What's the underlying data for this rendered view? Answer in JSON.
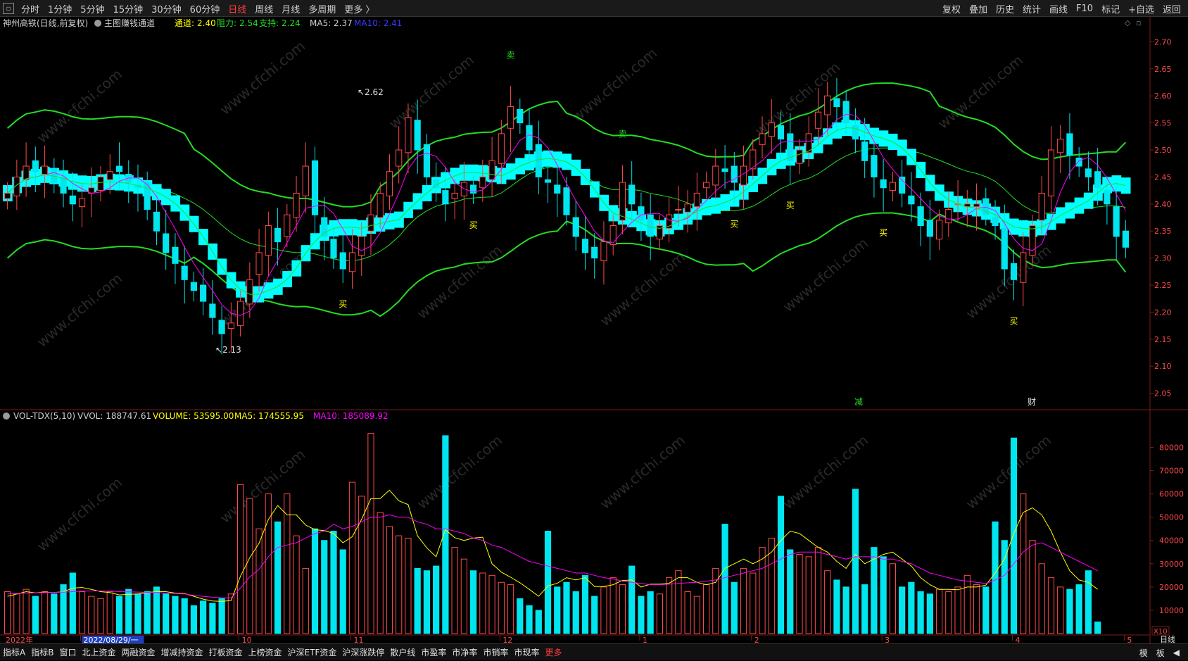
{
  "topbar": {
    "periods": [
      "分时",
      "1分钟",
      "5分钟",
      "15分钟",
      "30分钟",
      "60分钟",
      "日线",
      "周线",
      "月线",
      "多周期",
      "更多 〉"
    ],
    "active_period": "日线",
    "tools": [
      "复权",
      "叠加",
      "历史",
      "统计",
      "画线",
      "F10",
      "标记",
      "+自选",
      "返回"
    ]
  },
  "price_header": {
    "stock": "神州高铁(日线,前复权)",
    "indicator": "主图赚钱通道",
    "channel_label": "通道:",
    "channel_value": "2.40",
    "resist_label": "阻力:",
    "resist_value": "2.54",
    "support_label": "支持:",
    "support_value": "2.24",
    "ma5": "MA5: 2.37",
    "ma10": "MA10: 2.41"
  },
  "volume_header": {
    "name": "VOL-TDX(5,10)",
    "vvol": "VVOL: 188747.61",
    "volume": "VOLUME: 53595.00",
    "ma5": "MA5: 174555.95",
    "ma10": "MA10: 185089.92"
  },
  "annotations": {
    "high_label": "2.62",
    "low_label": "2.13",
    "buy": "买",
    "sell": "卖",
    "event_reduce": "减",
    "event_fin": "财",
    "unit_badge": "X10",
    "period_badge": "日线"
  },
  "axes": {
    "price_ticks": [
      "2.70",
      "2.65",
      "2.60",
      "2.55",
      "2.50",
      "2.45",
      "2.40",
      "2.35",
      "2.30",
      "2.25",
      "2.20",
      "2.15",
      "2.10",
      "2.05"
    ],
    "volume_ticks": [
      "80000",
      "70000",
      "60000",
      "50000",
      "40000",
      "30000",
      "20000",
      "10000"
    ],
    "time_labels": [
      "2022年",
      "2022/08/29/一",
      "10",
      "11",
      "12",
      "1",
      "2",
      "3",
      "4",
      "5"
    ]
  },
  "bottom_tabs": [
    "指标A",
    "指标B",
    "窗口",
    "北上资金",
    "两融资金",
    "增减持资金",
    "打板资金",
    "上榜资金",
    "沪深ETF资金",
    "沪深涨跌停",
    "散户线",
    "市盈率",
    "市净率",
    "市销率",
    "市现率",
    "更多"
  ],
  "bottom_right": [
    "模",
    "板",
    "◀"
  ],
  "watermark": "www.cfchi.com",
  "colors": {
    "up": "#ff4a4a",
    "down": "#00e5ee",
    "ma5": "#ffff00",
    "ma10": "#ff00ff",
    "band": "#22dd22",
    "channel": "#00ffff",
    "buy_text": "#ffff00",
    "sell_text": "#22dd22"
  },
  "chart_data": {
    "type": "candlestick",
    "title": "神州高铁(日线,前复权)",
    "ylim_price": [
      2.03,
      2.72
    ],
    "ylim_volume": [
      0,
      88000
    ],
    "price_extremes": {
      "high": 2.62,
      "low": 2.13
    },
    "closes": [
      2.42,
      2.45,
      2.47,
      2.46,
      2.47,
      2.44,
      2.42,
      2.4,
      2.41,
      2.43,
      2.45,
      2.46,
      2.46,
      2.44,
      2.43,
      2.39,
      2.35,
      2.31,
      2.29,
      2.26,
      2.24,
      2.22,
      2.19,
      2.16,
      2.18,
      2.22,
      2.26,
      2.31,
      2.36,
      2.33,
      2.38,
      2.42,
      2.47,
      2.38,
      2.34,
      2.3,
      2.28,
      2.31,
      2.34,
      2.38,
      2.42,
      2.46,
      2.5,
      2.56,
      2.5,
      2.45,
      2.43,
      2.4,
      2.42,
      2.44,
      2.42,
      2.45,
      2.48,
      2.53,
      2.58,
      2.55,
      2.5,
      2.45,
      2.44,
      2.42,
      2.38,
      2.34,
      2.31,
      2.3,
      2.33,
      2.36,
      2.44,
      2.4,
      2.37,
      2.34,
      2.36,
      2.38,
      2.39,
      2.4,
      2.42,
      2.44,
      2.47,
      2.46,
      2.44,
      2.47,
      2.5,
      2.53,
      2.55,
      2.52,
      2.48,
      2.5,
      2.53,
      2.57,
      2.6,
      2.58,
      2.55,
      2.52,
      2.48,
      2.45,
      2.43,
      2.44,
      2.42,
      2.4,
      2.36,
      2.34,
      2.37,
      2.39,
      2.4,
      2.4,
      2.4,
      2.38,
      2.36,
      2.28,
      2.26,
      2.31,
      2.36,
      2.42,
      2.5,
      2.52,
      2.49,
      2.47,
      2.45,
      2.43,
      2.4,
      2.34,
      2.32
    ],
    "volumes": [
      18000,
      17000,
      19000,
      16000,
      18000,
      17000,
      21000,
      26000,
      18000,
      16000,
      15000,
      18000,
      16000,
      19000,
      17000,
      18000,
      20000,
      17000,
      16000,
      15000,
      12000,
      14000,
      13000,
      15000,
      17000,
      64000,
      58000,
      45000,
      60000,
      48000,
      60000,
      42000,
      28000,
      45000,
      40000,
      44000,
      36000,
      65000,
      59000,
      86000,
      52000,
      46000,
      42000,
      41000,
      28000,
      27000,
      29000,
      85000,
      37000,
      32000,
      27000,
      26000,
      25000,
      22000,
      21000,
      15000,
      12000,
      10000,
      44000,
      20000,
      22000,
      18000,
      25000,
      16000,
      20000,
      24000,
      21000,
      29000,
      16000,
      18000,
      17000,
      24000,
      27000,
      18000,
      16000,
      21000,
      28000,
      47000,
      22000,
      28000,
      26000,
      37000,
      41000,
      59000,
      36000,
      34000,
      33000,
      37000,
      27000,
      23000,
      20000,
      62000,
      21000,
      37000,
      33000,
      30000,
      20000,
      22000,
      18000,
      17000,
      19000,
      18000,
      20000,
      25000,
      21000,
      20000,
      48000,
      40000,
      84000,
      60000,
      40000,
      30000,
      24000,
      20000,
      19000,
      21000,
      27000,
      5000
    ],
    "vol_ma5": [
      16000,
      17000,
      18000,
      17500,
      17800,
      17600,
      18000,
      19500,
      19800,
      19000,
      18000,
      17600,
      16600,
      16800,
      17000,
      17600,
      18000,
      18000,
      17400,
      17200,
      16000,
      14800,
      14000,
      13800,
      14200,
      24600,
      32600,
      38800,
      49000,
      55000,
      51000,
      51000,
      46600,
      44600,
      44200,
      43000,
      39000,
      41600,
      49000,
      58000,
      58000,
      61600,
      57000,
      55400,
      42000,
      36800,
      33000,
      44600,
      41200,
      40000,
      41000,
      41400,
      30000,
      26400,
      24200,
      21800,
      19000,
      16000,
      20400,
      21600,
      24000,
      23000,
      24000,
      20200,
      20200,
      21000,
      22800,
      23000,
      20000,
      21200,
      21200,
      21600,
      24000,
      24000,
      22000,
      21000,
      22000,
      28000,
      30000,
      32000,
      30000,
      32000,
      35000,
      40000,
      44000,
      43000,
      40000,
      37000,
      35000,
      31000,
      28000,
      34000,
      30000,
      32000,
      34000,
      35000,
      32000,
      29000,
      24000,
      21000,
      19000,
      19000,
      18800,
      20000,
      20000,
      20800,
      26000,
      32000,
      43000,
      52000,
      54000,
      51000,
      44000,
      35000,
      27000,
      23000,
      22000,
      19000
    ],
    "vol_ma10": [
      17000,
      17200,
      17400,
      17500,
      17600,
      17700,
      17800,
      18000,
      18200,
      18300,
      18300,
      18200,
      18000,
      17900,
      17800,
      17700,
      17600,
      17400,
      17200,
      17000,
      16400,
      16000,
      15600,
      15400,
      15300,
      19500,
      24400,
      27600,
      33000,
      37000,
      38000,
      39000,
      41000,
      43000,
      44000,
      47000,
      45000,
      46000,
      48000,
      50000,
      50000,
      51000,
      50000,
      50000,
      48000,
      47000,
      45000,
      45000,
      44000,
      43000,
      41000,
      40000,
      38000,
      37000,
      35000,
      33000,
      31000,
      30000,
      29000,
      28000,
      27000,
      26000,
      26000,
      25000,
      24000,
      23500,
      22500,
      22000,
      21500,
      21000,
      21000,
      21200,
      21500,
      21800,
      22000,
      22500,
      23000,
      24000,
      25000,
      26000,
      27000,
      28000,
      30000,
      32000,
      34000,
      35000,
      35000,
      35000,
      34000,
      33000,
      32000,
      33000,
      33000,
      33000,
      32000,
      32000,
      31000,
      30000,
      28000,
      26000,
      25000,
      24000,
      23000,
      22500,
      22000,
      21500,
      23000,
      25000,
      30000,
      35000,
      38000,
      39000,
      37000,
      35000,
      33000,
      31000,
      29000,
      27000
    ]
  }
}
